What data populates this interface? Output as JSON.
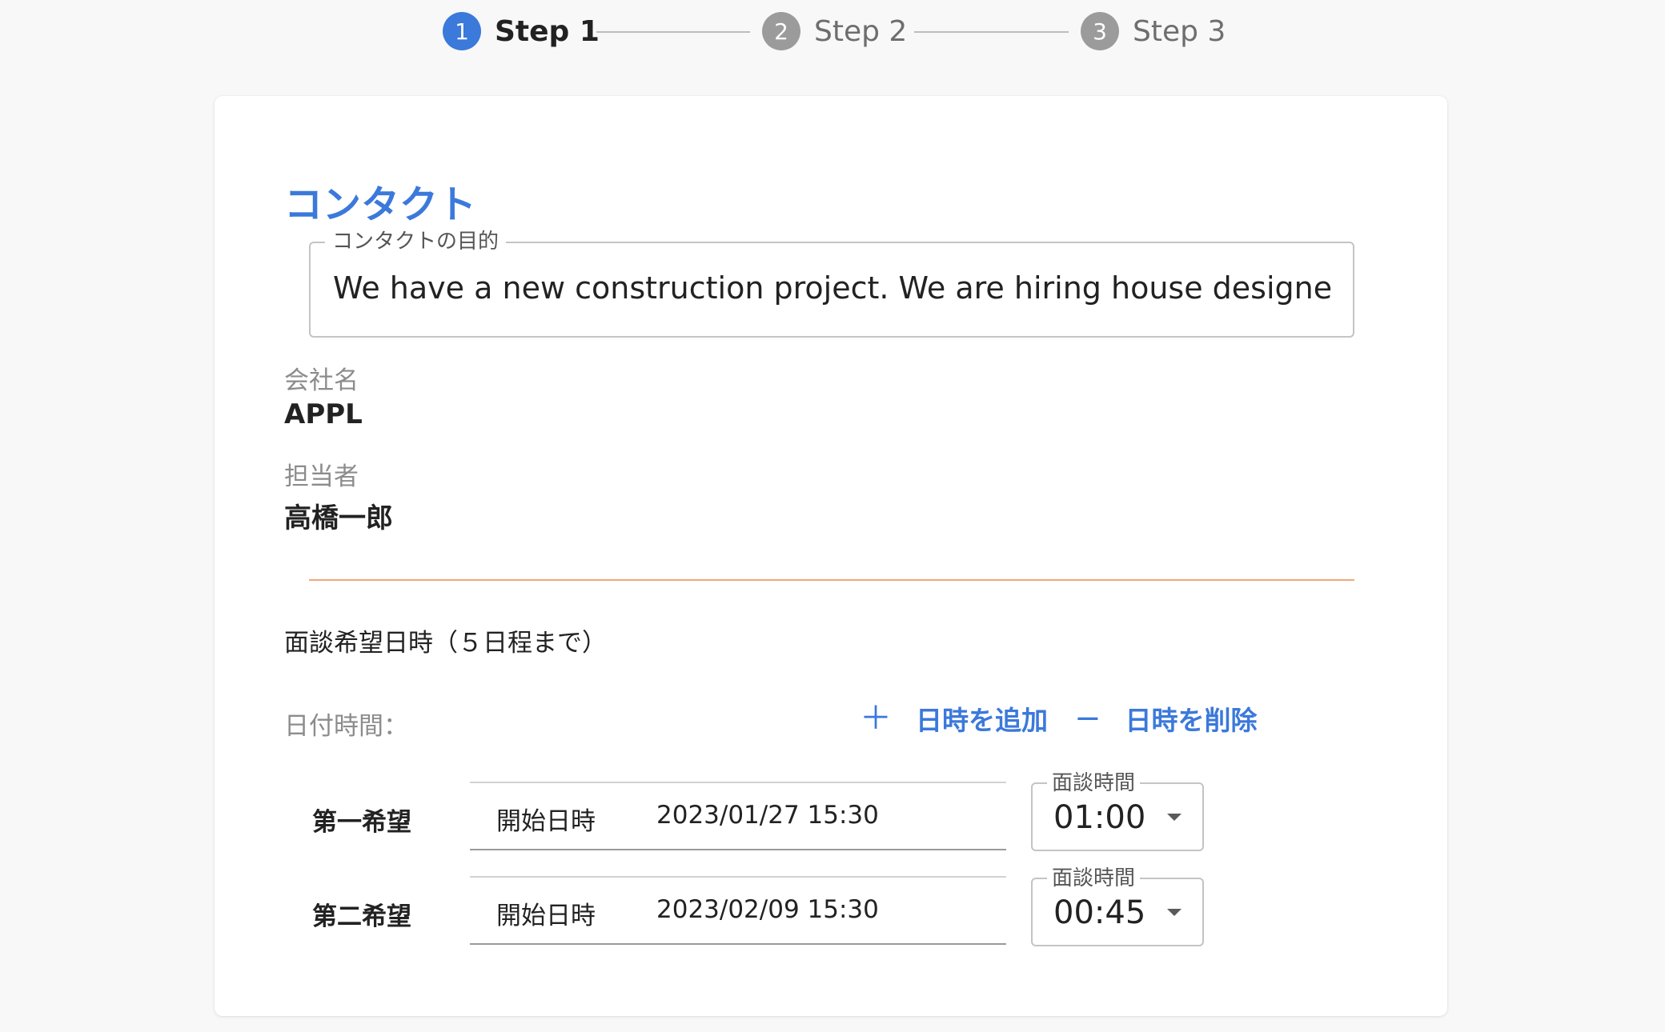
{
  "stepper": {
    "steps": [
      {
        "number": "1",
        "label": "Step 1",
        "state": "active"
      },
      {
        "number": "2",
        "label": "Step 2",
        "state": "inactive"
      },
      {
        "number": "3",
        "label": "Step 3",
        "state": "inactive"
      }
    ]
  },
  "contact": {
    "title": "コンタクト",
    "purpose": {
      "label": "コンタクトの目的",
      "value": "We have a new construction project. We are hiring house designers"
    },
    "company": {
      "label": "会社名",
      "value": "APPL"
    },
    "person": {
      "label": "担当者",
      "value": "高橋一郎"
    }
  },
  "schedule": {
    "heading": "面談希望日時（５日程まで）",
    "datetime_label": "日付時間：",
    "add_label": "日時を追加",
    "remove_label": "日時を削除",
    "add_icon": "＋",
    "remove_icon": "−",
    "preferences": [
      {
        "label": "第一希望",
        "start_label": "開始日時",
        "start_value": "2023/01/27 15:30",
        "duration_label": "面談時間",
        "duration_value": "01:00"
      },
      {
        "label": "第二希望",
        "start_label": "開始日時",
        "start_value": "2023/02/09 15:30",
        "duration_label": "面談時間",
        "duration_value": "00:45"
      }
    ]
  },
  "colors": {
    "accent": "#3b79db",
    "inactive_step": "#9b9b9b",
    "divider": "#f0a77a",
    "background": "#f8f8f8"
  }
}
